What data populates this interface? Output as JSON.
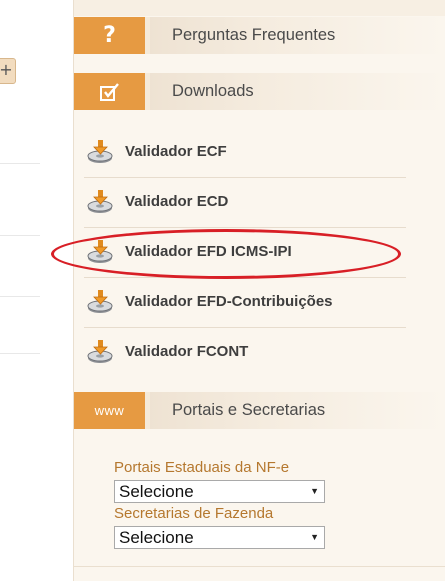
{
  "sections": {
    "faq": {
      "title": "Perguntas Frequentes",
      "icon": "question-mark-icon",
      "glyph": "?"
    },
    "downloads": {
      "title": "Downloads",
      "icon": "checkbox-icon",
      "items": [
        {
          "label": "Validador ECF",
          "icon": "download-disk-icon"
        },
        {
          "label": "Validador ECD",
          "icon": "download-disk-icon"
        },
        {
          "label": "Validador EFD ICMS-IPI",
          "icon": "download-disk-icon"
        },
        {
          "label": "Validador EFD-Contribuições",
          "icon": "download-disk-icon"
        },
        {
          "label": "Validador FCONT",
          "icon": "download-disk-icon"
        }
      ]
    },
    "portals": {
      "title": "Portais e Secretarias",
      "icon_text": "www",
      "fields": [
        {
          "label": "Portais Estaduais da NF-e",
          "selected": "Selecione"
        },
        {
          "label": "Secretarias de Fazenda",
          "selected": "Selecione"
        }
      ]
    }
  },
  "left": {
    "plus_label": "+"
  },
  "colors": {
    "accent": "#e69a42",
    "panel_bg": "#fbf6ee",
    "highlight": "#d81f26",
    "label_brown": "#b5782f"
  }
}
